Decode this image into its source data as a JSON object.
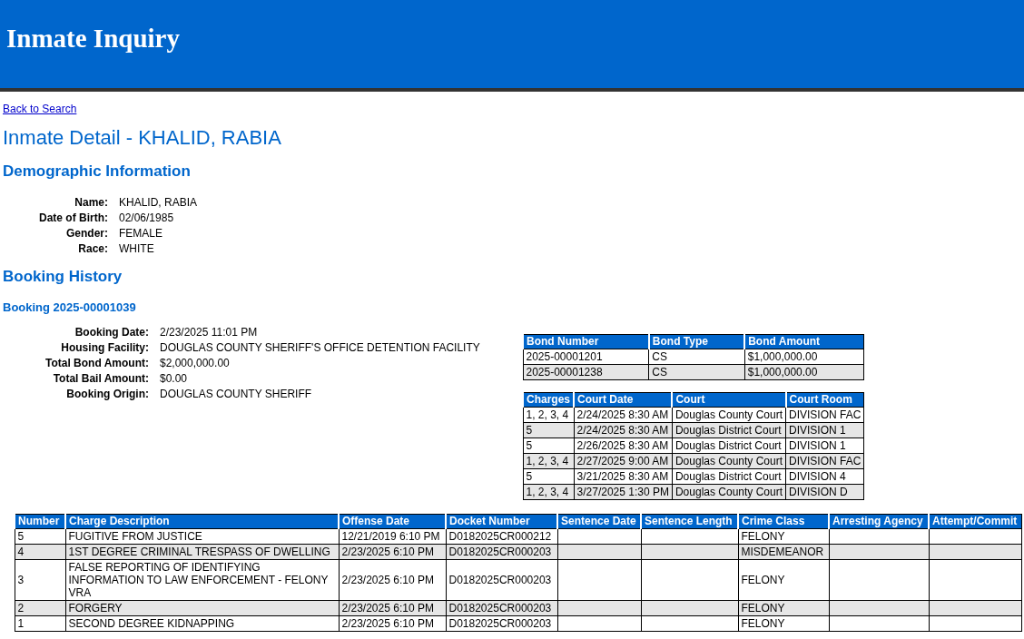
{
  "header": {
    "title": "Inmate Inquiry"
  },
  "back_link": "Back to Search",
  "page_title": "Inmate Detail - KHALID, RABIA",
  "demographics": {
    "heading": "Demographic Information",
    "fields": [
      {
        "label": "Name:",
        "value": "KHALID, RABIA"
      },
      {
        "label": "Date of Birth:",
        "value": "02/06/1985"
      },
      {
        "label": "Gender:",
        "value": "FEMALE"
      },
      {
        "label": "Race:",
        "value": "WHITE"
      }
    ]
  },
  "booking_history": {
    "heading": "Booking History",
    "booking_heading": "Booking 2025-00001039",
    "fields": [
      {
        "label": "Booking Date:",
        "value": "2/23/2025 11:01 PM"
      },
      {
        "label": "Housing Facility:",
        "value": "DOUGLAS COUNTY SHERIFF'S OFFICE DETENTION FACILITY"
      },
      {
        "label": "Total Bond Amount:",
        "value": "$2,000,000.00"
      },
      {
        "label": "Total Bail Amount:",
        "value": "$0.00"
      },
      {
        "label": "Booking Origin:",
        "value": "DOUGLAS COUNTY SHERIFF"
      }
    ],
    "bonds": {
      "columns": [
        "Bond Number",
        "Bond Type",
        "Bond Amount"
      ],
      "rows": [
        [
          "2025-00001201",
          "CS",
          "$1,000,000.00"
        ],
        [
          "2025-00001238",
          "CS",
          "$1,000,000.00"
        ]
      ]
    },
    "court_dates": {
      "columns": [
        "Charges",
        "Court Date",
        "Court",
        "Court Room"
      ],
      "rows": [
        [
          "1, 2, 3, 4",
          "2/24/2025 8:30 AM",
          "Douglas County Court",
          "DIVISION FAC"
        ],
        [
          "5",
          "2/24/2025 8:30 AM",
          "Douglas District Court",
          "DIVISION 1"
        ],
        [
          "5",
          "2/26/2025 8:30 AM",
          "Douglas District Court",
          "DIVISION 1"
        ],
        [
          "1, 2, 3, 4",
          "2/27/2025 9:00 AM",
          "Douglas County Court",
          "DIVISION FAC"
        ],
        [
          "5",
          "3/21/2025 8:30 AM",
          "Douglas District Court",
          "DIVISION 4"
        ],
        [
          "1, 2, 3, 4",
          "3/27/2025 1:30 PM",
          "Douglas County Court",
          "DIVISION D"
        ]
      ]
    },
    "charges": {
      "columns": [
        "Number",
        "Charge Description",
        "Offense Date",
        "Docket Number",
        "Sentence Date",
        "Sentence Length",
        "Crime Class",
        "Arresting Agency",
        "Attempt/Commit"
      ],
      "rows": [
        {
          "number": "5",
          "description": "FUGITIVE FROM JUSTICE",
          "offense_date": "12/21/2019 6:10 PM",
          "docket_number": "D0182025CR000212",
          "crime_class": "FELONY"
        },
        {
          "number": "4",
          "description": "1ST DEGREE CRIMINAL TRESPASS OF DWELLING",
          "offense_date": "2/23/2025 6:10 PM",
          "docket_number": "D0182025CR000203",
          "crime_class": "MISDEMEANOR"
        },
        {
          "number": "3",
          "description": "FALSE REPORTING OF IDENTIFYING INFORMATION TO LAW ENFORCEMENT - FELONY VRA",
          "offense_date": "2/23/2025 6:10 PM",
          "docket_number": "D0182025CR000203",
          "crime_class": "FELONY"
        },
        {
          "number": "2",
          "description": "FORGERY",
          "offense_date": "2/23/2025 6:10 PM",
          "docket_number": "D0182025CR000203",
          "crime_class": "FELONY"
        },
        {
          "number": "1",
          "description": "SECOND DEGREE KIDNAPPING",
          "offense_date": "2/23/2025 6:10 PM",
          "docket_number": "D0182025CR000203",
          "crime_class": "FELONY"
        }
      ]
    }
  }
}
